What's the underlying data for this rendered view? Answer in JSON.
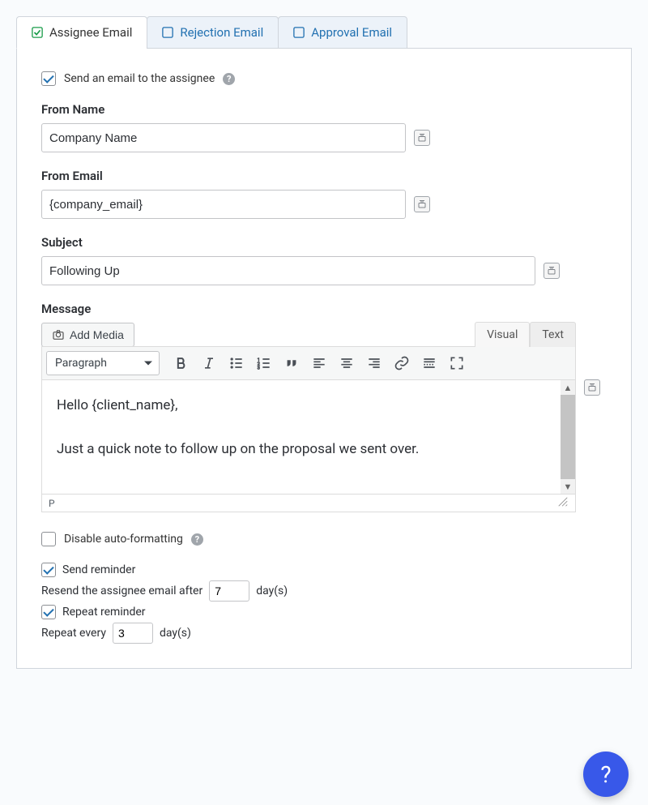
{
  "tabs": [
    {
      "label": "Assignee Email",
      "checked": true
    },
    {
      "label": "Rejection Email",
      "checked": false
    },
    {
      "label": "Approval Email",
      "checked": false
    }
  ],
  "send_email": {
    "label": "Send an email to the assignee",
    "checked": true
  },
  "fields": {
    "from_name": {
      "label": "From Name",
      "value": "Company Name"
    },
    "from_email": {
      "label": "From Email",
      "value": "{company_email}"
    },
    "subject": {
      "label": "Subject",
      "value": "Following Up"
    },
    "message_label": "Message"
  },
  "editor": {
    "add_media": "Add Media",
    "tabs": {
      "visual": "Visual",
      "text": "Text"
    },
    "format_select": "Paragraph",
    "content_line1": "Hello {client_name},",
    "content_line2": "Just a quick note to follow up on the proposal we sent over.",
    "status_path": "P"
  },
  "disable_autoformat": {
    "label": "Disable auto-formatting",
    "checked": false
  },
  "reminder": {
    "send_label": "Send reminder",
    "send_checked": true,
    "resend_prefix": "Resend the assignee email after",
    "resend_value": "7",
    "resend_suffix": "day(s)",
    "repeat_label": "Repeat reminder",
    "repeat_checked": true,
    "repeat_prefix": "Repeat every",
    "repeat_value": "3",
    "repeat_suffix": "day(s)"
  },
  "help_glyph": "?"
}
